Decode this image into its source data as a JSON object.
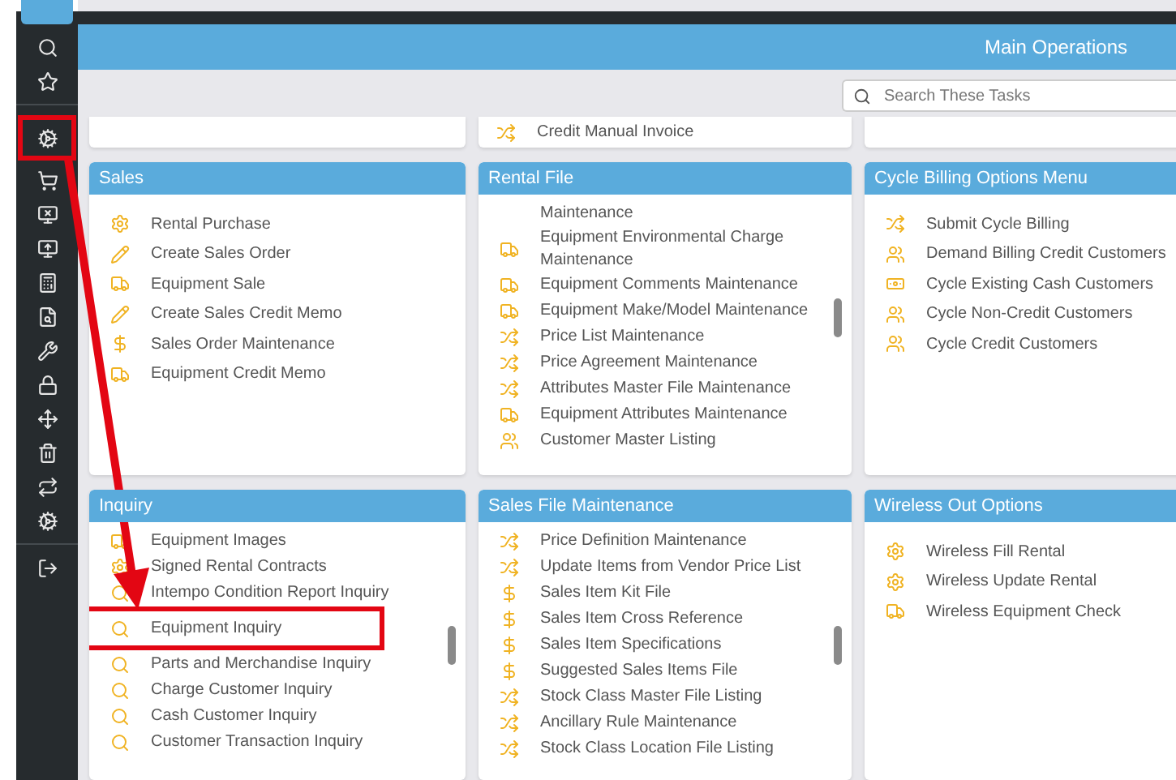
{
  "header": {
    "title": "Main Operations"
  },
  "search": {
    "placeholder": "Search These Tasks"
  },
  "sidebar": {
    "groups": [
      {
        "items": [
          {
            "kind": "search",
            "highlighted": false
          },
          {
            "kind": "star",
            "highlighted": false
          }
        ]
      },
      {
        "items": [
          {
            "kind": "cogs",
            "highlighted": true
          },
          {
            "kind": "cart",
            "highlighted": false
          },
          {
            "kind": "return",
            "highlighted": false
          },
          {
            "kind": "send",
            "highlighted": false
          },
          {
            "kind": "calculator",
            "highlighted": false
          },
          {
            "kind": "file-search",
            "highlighted": false
          },
          {
            "kind": "wrench",
            "highlighted": false
          },
          {
            "kind": "lock",
            "highlighted": false
          },
          {
            "kind": "move",
            "highlighted": false
          },
          {
            "kind": "trash",
            "highlighted": false
          },
          {
            "kind": "repeat",
            "highlighted": false
          },
          {
            "kind": "cogs",
            "highlighted": false
          }
        ]
      },
      {
        "items": [
          {
            "kind": "logout",
            "highlighted": false
          }
        ]
      }
    ]
  },
  "top_row_items": [
    {
      "kind": "shuffle",
      "label": "Credit Manual Invoice"
    }
  ],
  "panels": [
    {
      "title": "Sales",
      "scrollable": false,
      "items": [
        {
          "kind": "gear",
          "label": "Rental Purchase",
          "highlighted": false
        },
        {
          "kind": "pencil",
          "label": "Create Sales Order",
          "highlighted": false
        },
        {
          "kind": "truck",
          "label": "Equipment Sale",
          "highlighted": false
        },
        {
          "kind": "pencil",
          "label": "Create Sales Credit Memo",
          "highlighted": false
        },
        {
          "kind": "dollar",
          "label": "Sales Order Maintenance",
          "highlighted": false
        },
        {
          "kind": "truck",
          "label": "Equipment Credit Memo",
          "highlighted": false
        }
      ]
    },
    {
      "title": "Rental File",
      "scrollable": true,
      "items": [
        {
          "kind": "text",
          "label": "Maintenance",
          "highlighted": false
        },
        {
          "kind": "truck",
          "label": "Equipment Environmental Charge Maintenance",
          "highlighted": false
        },
        {
          "kind": "truck",
          "label": "Equipment Comments Maintenance",
          "highlighted": false
        },
        {
          "kind": "truck",
          "label": "Equipment Make/Model Maintenance",
          "highlighted": false
        },
        {
          "kind": "shuffle",
          "label": "Price List Maintenance",
          "highlighted": false
        },
        {
          "kind": "shuffle",
          "label": "Price Agreement Maintenance",
          "highlighted": false
        },
        {
          "kind": "shuffle",
          "label": "Attributes Master File Maintenance",
          "highlighted": false
        },
        {
          "kind": "truck",
          "label": "Equipment Attributes Maintenance",
          "highlighted": false
        },
        {
          "kind": "users",
          "label": "Customer Master Listing",
          "highlighted": false
        }
      ]
    },
    {
      "title": "Cycle Billing Options Menu",
      "scrollable": false,
      "items": [
        {
          "kind": "shuffle",
          "label": "Submit Cycle Billing",
          "highlighted": false
        },
        {
          "kind": "users",
          "label": "Demand Billing Credit Customers",
          "highlighted": false
        },
        {
          "kind": "cash",
          "label": "Cycle Existing Cash Customers",
          "highlighted": false
        },
        {
          "kind": "users",
          "label": "Cycle Non-Credit Customers",
          "highlighted": false
        },
        {
          "kind": "users",
          "label": "Cycle Credit Customers",
          "highlighted": false
        }
      ]
    },
    {
      "title": "Inquiry",
      "scrollable": true,
      "items": [
        {
          "kind": "truck",
          "label": "Equipment Images",
          "highlighted": false
        },
        {
          "kind": "gear",
          "label": "Signed Rental Contracts",
          "highlighted": false
        },
        {
          "kind": "search",
          "label": "Intempo Condition Report Inquiry",
          "highlighted": false
        },
        {
          "kind": "search",
          "label": "Equipment Inquiry",
          "highlighted": true
        },
        {
          "kind": "search",
          "label": "Parts and Merchandise Inquiry",
          "highlighted": false
        },
        {
          "kind": "search",
          "label": "Charge Customer Inquiry",
          "highlighted": false
        },
        {
          "kind": "search",
          "label": "Cash Customer Inquiry",
          "highlighted": false
        },
        {
          "kind": "search",
          "label": "Customer Transaction Inquiry",
          "highlighted": false
        }
      ]
    },
    {
      "title": "Sales File Maintenance",
      "scrollable": true,
      "items": [
        {
          "kind": "shuffle",
          "label": "Price Definition Maintenance",
          "highlighted": false
        },
        {
          "kind": "shuffle",
          "label": "Update Items from Vendor Price List",
          "highlighted": false
        },
        {
          "kind": "dollar",
          "label": "Sales Item Kit File",
          "highlighted": false
        },
        {
          "kind": "dollar",
          "label": "Sales Item Cross Reference",
          "highlighted": false
        },
        {
          "kind": "dollar",
          "label": "Sales Item Specifications",
          "highlighted": false
        },
        {
          "kind": "dollar",
          "label": "Suggested Sales Items File",
          "highlighted": false
        },
        {
          "kind": "shuffle",
          "label": "Stock Class Master File Listing",
          "highlighted": false
        },
        {
          "kind": "shuffle",
          "label": "Ancillary Rule Maintenance",
          "highlighted": false
        },
        {
          "kind": "shuffle",
          "label": "Stock Class Location File Listing",
          "highlighted": false
        }
      ]
    },
    {
      "title": "Wireless Out Options",
      "scrollable": false,
      "items": [
        {
          "kind": "gear",
          "label": "Wireless Fill Rental",
          "highlighted": false
        },
        {
          "kind": "gear",
          "label": "Wireless Update Rental",
          "highlighted": false
        },
        {
          "kind": "truck",
          "label": "Wireless Equipment Check",
          "highlighted": false
        }
      ]
    }
  ]
}
